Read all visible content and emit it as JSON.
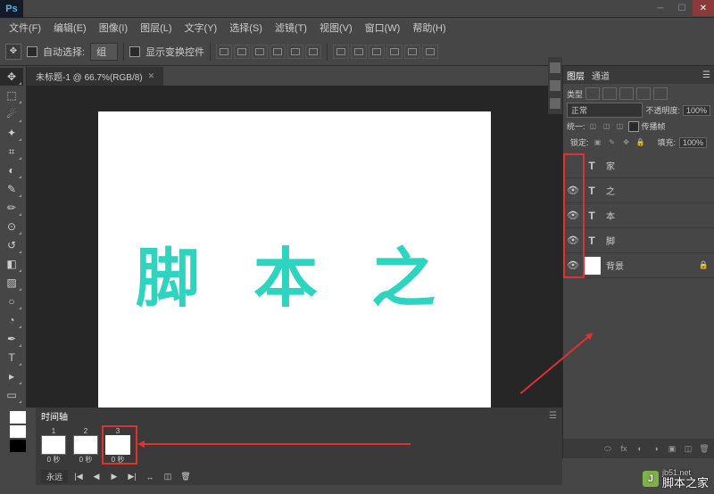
{
  "app": {
    "logo": "Ps"
  },
  "menubar": [
    "文件(F)",
    "编辑(E)",
    "图像(I)",
    "图层(L)",
    "文字(Y)",
    "选择(S)",
    "滤镜(T)",
    "视图(V)",
    "窗口(W)",
    "帮助(H)"
  ],
  "options": {
    "auto_select": "自动选择:",
    "auto_select_type": "组",
    "show_transform": "显示变换控件"
  },
  "document": {
    "tab": "未标题-1 @ 66.7%(RGB/8)",
    "canvas_text": "脚 本 之"
  },
  "layers_panel": {
    "tabs": [
      "图层",
      "通道"
    ],
    "kind": "类型",
    "blend_mode": "正常",
    "opacity_label": "不透明度:",
    "opacity_value": "100%",
    "lock_label": "锁定:",
    "fill_label": "填充:",
    "fill_value": "100%",
    "unify_label": "统一:",
    "propagate": "传播帧",
    "layers": [
      {
        "visible": false,
        "type": "T",
        "name": "家"
      },
      {
        "visible": true,
        "type": "T",
        "name": "之"
      },
      {
        "visible": true,
        "type": "T",
        "name": "本"
      },
      {
        "visible": true,
        "type": "T",
        "name": "脚"
      },
      {
        "visible": true,
        "type": "bg",
        "name": "背景",
        "locked": true
      }
    ]
  },
  "timeline": {
    "title": "时间轴",
    "frames": [
      {
        "num": "1",
        "delay": "0 秒"
      },
      {
        "num": "2",
        "delay": "0 秒"
      },
      {
        "num": "3",
        "delay": "0 秒"
      }
    ],
    "loop": "永远"
  },
  "watermark": {
    "url": "jb51.net",
    "name": "脚本之家",
    "logo": "J"
  }
}
